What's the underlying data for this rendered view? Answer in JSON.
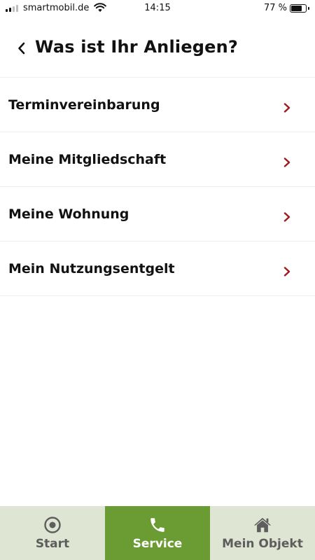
{
  "status_bar": {
    "carrier": "smartmobil.de",
    "time": "14:15",
    "battery_text": "77 %",
    "battery_level": 0.77,
    "signal_bars_active": 2,
    "signal_bars_total": 4
  },
  "header": {
    "back_icon": "chevron-left-icon",
    "title": "Was ist Ihr Anliegen?"
  },
  "menu": {
    "items": [
      {
        "label": "Terminvereinbarung",
        "icon": "chevron-right-icon"
      },
      {
        "label": "Meine Mitgliedschaft",
        "icon": "chevron-right-icon"
      },
      {
        "label": "Meine Wohnung",
        "icon": "chevron-right-icon"
      },
      {
        "label": "Mein Nutzungsentgelt",
        "icon": "chevron-right-icon"
      }
    ],
    "chevron_color": "#9b1b1f"
  },
  "tabbar": {
    "tabs": [
      {
        "label": "Start",
        "icon": "target-icon",
        "active": false
      },
      {
        "label": "Service",
        "icon": "phone-icon",
        "active": true
      },
      {
        "label": "Mein Objekt",
        "icon": "home-icon",
        "active": false
      }
    ],
    "active_color": "#6b9b33",
    "inactive_color": "#dfe5d3"
  }
}
